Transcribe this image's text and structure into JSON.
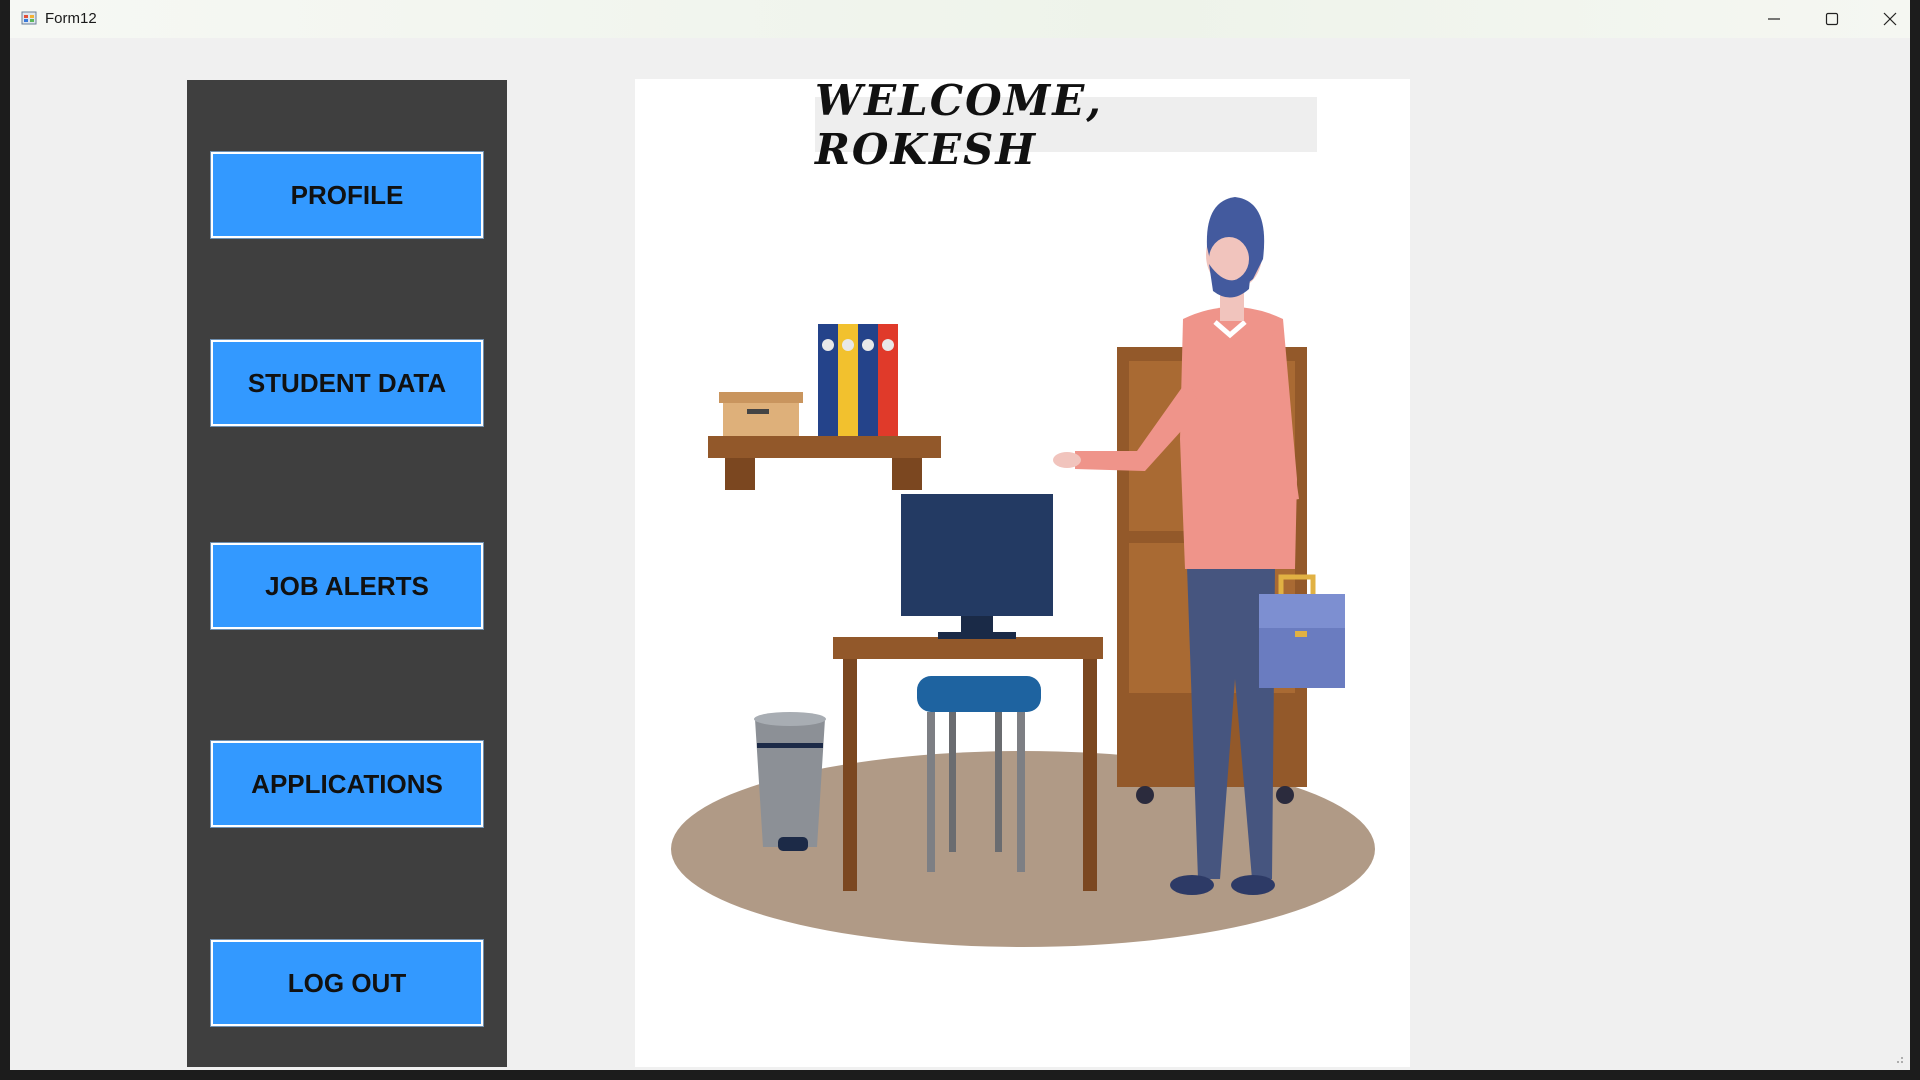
{
  "window": {
    "title": "Form12",
    "icon": "app-form-icon",
    "controls": [
      "minimize-icon",
      "maximize-icon",
      "close-icon"
    ]
  },
  "sidebar": {
    "background": "#3f3f3f",
    "buttons": [
      {
        "label": "PROFILE"
      },
      {
        "label": "STUDENT DATA"
      },
      {
        "label": "JOB ALERTS"
      },
      {
        "label": "APPLICATIONS"
      },
      {
        "label": "LOG OUT"
      }
    ],
    "button_color": "#3399ff"
  },
  "main": {
    "welcome_text": "WELCOME, ROKESH",
    "illustration": "office-man-with-briefcase-illustration"
  }
}
